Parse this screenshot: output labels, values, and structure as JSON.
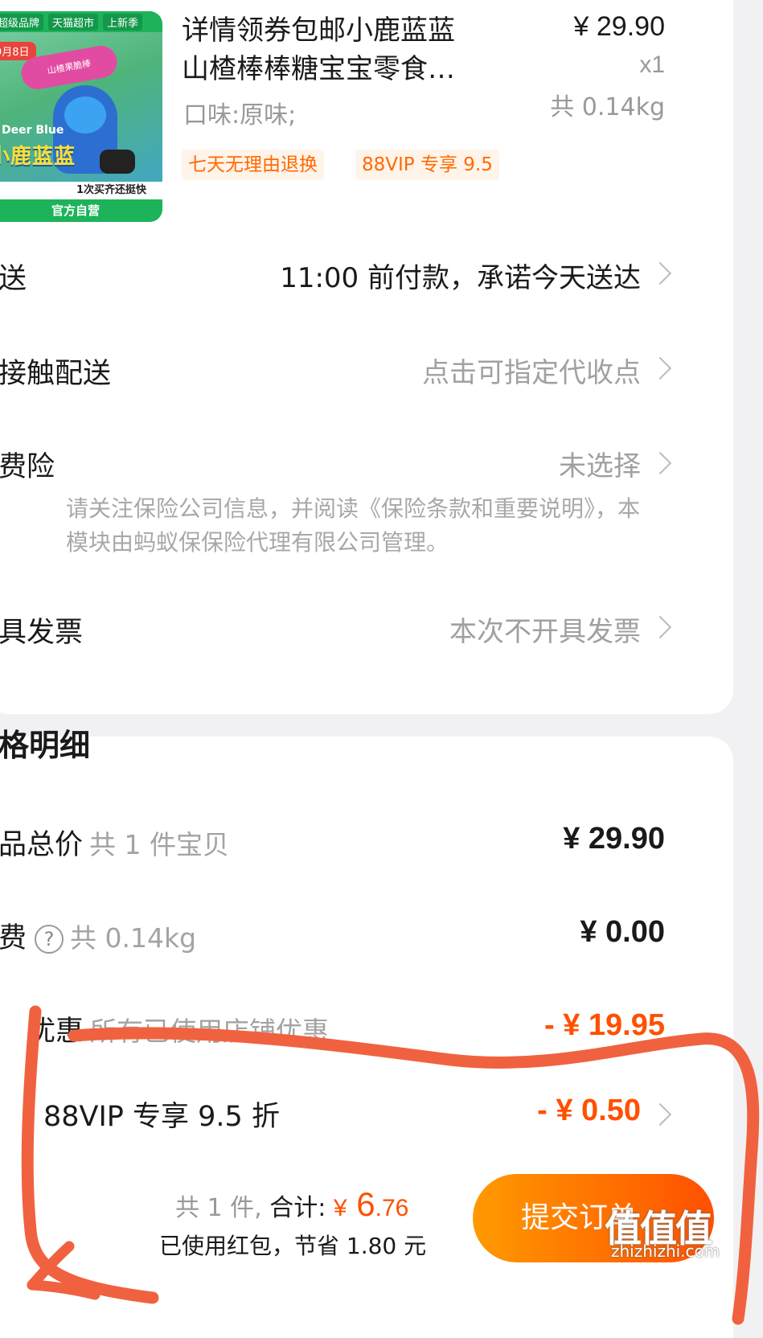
{
  "product": {
    "thumb_tags": [
      "超级品牌",
      "天猫超市",
      "上新季"
    ],
    "thumb_date": "9月8日",
    "thumb_cap": "山楂果脆棒",
    "thumb_brand_en": "Deer Blue",
    "thumb_brand_cn": "小鹿蓝蓝",
    "thumb_strip1": "1次买齐还挺快",
    "thumb_strip2": "官方自营",
    "title_line1": "详情领券包邮小鹿蓝蓝",
    "title_line2": "山楂棒棒糖宝宝零食…",
    "price": "¥ 29.90",
    "qty": "x1",
    "weight": "共 0.14kg",
    "flavor": "口味:原味;",
    "tags": [
      "七天无理由退换",
      "88VIP 专享 9.5"
    ]
  },
  "rows": {
    "delivery_label": "送",
    "delivery_value": "11:00 前付款，承诺今天送达",
    "contactless_label": "接触配送",
    "contactless_value": "点击可指定代收点",
    "insurance_label": "费险",
    "insurance_value": "未选择",
    "insurance_note": "请关注保险公司信息，并阅读《保险条款和重要说明》，本模块由蚂蚁保保险代理有限公司管理。",
    "invoice_label": "具发票",
    "invoice_value": "本次不开具发票"
  },
  "price_detail": {
    "title": "格明细",
    "total_label": "品总价",
    "total_sub": "共 1 件宝贝",
    "total_value": "¥ 29.90",
    "shipping_label": "费",
    "shipping_icon": "?",
    "shipping_sub": "共 0.14kg",
    "shipping_value": "¥ 0.00",
    "discount_label": "优惠",
    "discount_sub": "所有已使用店铺优惠",
    "discount_value": "- ¥ 19.95",
    "vip_label": "88VIP 专享 9.5 折",
    "vip_value": "- ¥ 0.50"
  },
  "footer": {
    "count": "共 1 件,",
    "total_label": "合计:",
    "currency": "¥",
    "amount_int": "6",
    "amount_dec": ".76",
    "saving": "已使用红包，节省 1.80 元",
    "submit": "提交订单"
  },
  "watermark": {
    "main": "值值值",
    "sub": "zhizhizhi.com"
  },
  "colors": {
    "accent": "#ff5000",
    "annotation": "#f0623f"
  }
}
